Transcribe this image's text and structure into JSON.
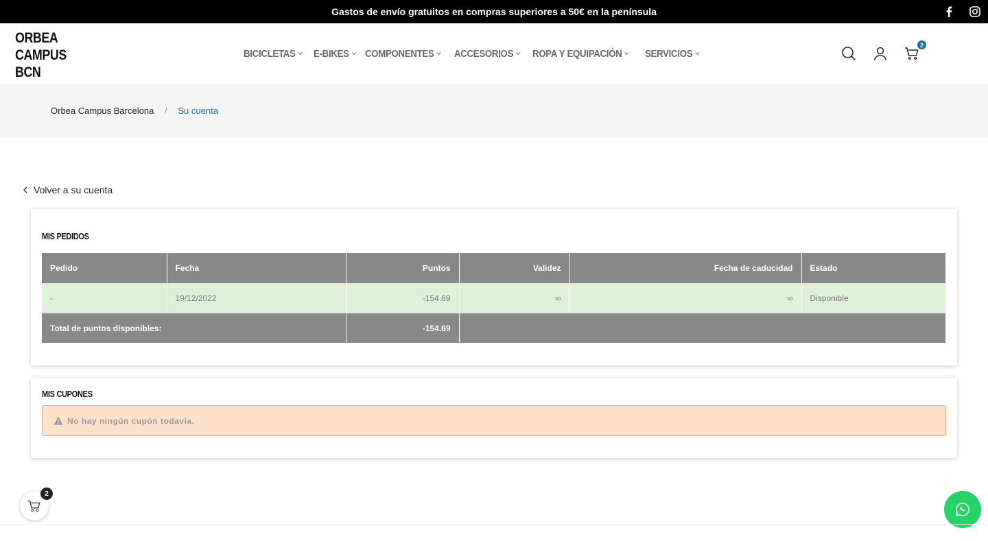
{
  "topbar": {
    "message": "Gastos de envío gratuitos en compras superiores a 50€ en la península",
    "social": [
      "facebook-icon",
      "instagram-icon"
    ]
  },
  "header": {
    "logo": [
      "ORBEA",
      "CAMPUS",
      "BCN"
    ],
    "nav": [
      "BICICLETAS",
      "E-BIKES",
      "COMPONENTES",
      "ACCESORIOS",
      "ROPA Y EQUIPACIÓN",
      "SERVICIOS"
    ],
    "cart_count": "2"
  },
  "breadcrumb": {
    "home": "Orbea Campus Barcelona",
    "separator": "/",
    "current": "Su cuenta"
  },
  "back_link": "Volver a su cuenta",
  "orders": {
    "title": "MIS PEDIDOS",
    "columns": [
      "Pedido",
      "Fecha",
      "Puntos",
      "Validez",
      "Fecha de caducidad",
      "Estado"
    ],
    "rows": [
      {
        "pedido": "-",
        "fecha": "19/12/2022",
        "puntos": "-154.69",
        "validez": "∞",
        "caducidad": "∞",
        "estado": "Disponible"
      }
    ],
    "total_label": "Total de puntos disponibles:",
    "total_value": "-154.69"
  },
  "coupons": {
    "title": "MIS CUPONES",
    "empty_message": "No hay ningún cupón todavía."
  },
  "floating_cart_count": "2",
  "colors": {
    "accent": "#1c6fb0",
    "table_header": "#888888",
    "row_success": "#def0d8",
    "alert_bg": "#fde1cb",
    "alert_border": "#e8a56e",
    "whatsapp": "#25d366"
  }
}
